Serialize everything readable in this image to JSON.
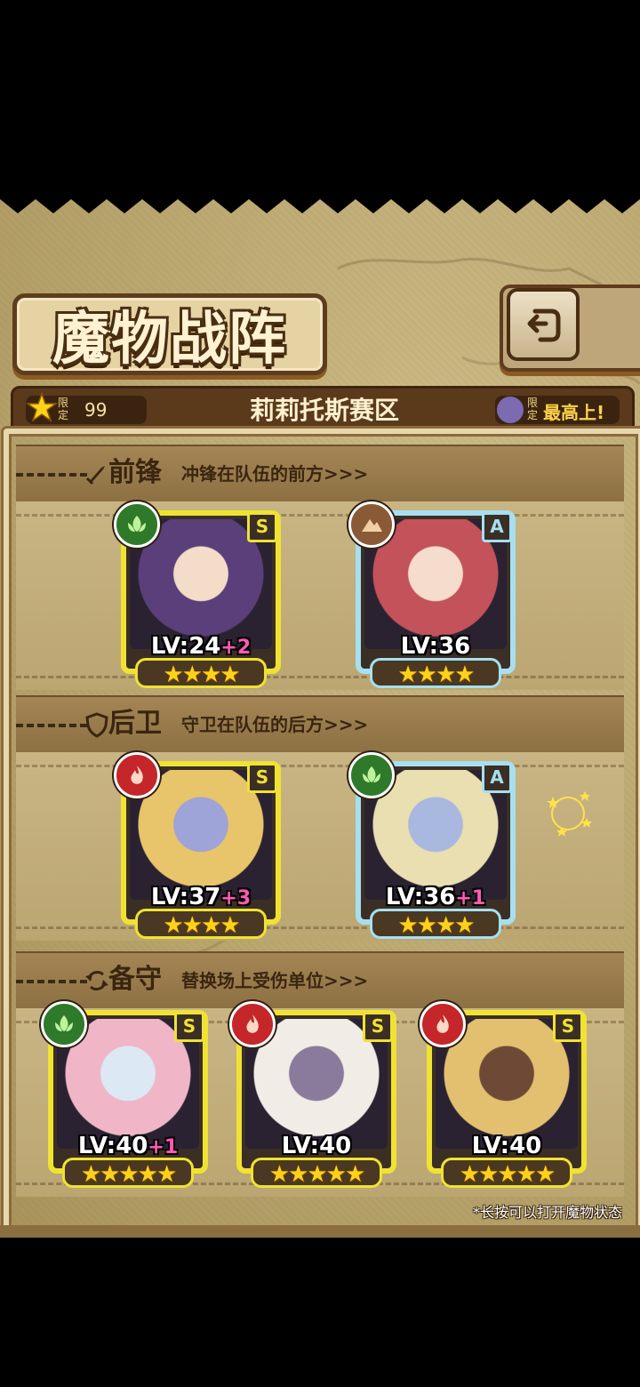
{
  "title": "魔物战阵",
  "header": {
    "limit_tag": "限定",
    "limit_value": "99",
    "region": "莉莉托斯赛区",
    "max_tag": "限定",
    "max_value": "最高上!"
  },
  "sections": [
    {
      "title": "前锋",
      "desc": "冲锋在队伍的前方>>>",
      "icon": "sword-icon"
    },
    {
      "title": "后卫",
      "desc": "守卫在队伍的后方>>>",
      "icon": "shield-icon"
    },
    {
      "title": "备守",
      "desc": "替换场上受伤单位>>>",
      "icon": "swap-icon"
    }
  ],
  "cards": [
    {
      "rank": "S",
      "element": "grass-icon",
      "lv": "LV:24",
      "plus": "+2",
      "stars": 4
    },
    {
      "rank": "A",
      "element": "earth-icon",
      "lv": "LV:36",
      "plus": "",
      "stars": 4
    },
    {
      "rank": "S",
      "element": "fire-icon",
      "lv": "LV:37",
      "plus": "+3",
      "stars": 4
    },
    {
      "rank": "A",
      "element": "grass-icon",
      "lv": "LV:36",
      "plus": "+1",
      "stars": 4
    },
    {
      "rank": "S",
      "element": "grass-icon",
      "lv": "LV:40",
      "plus": "+1",
      "stars": 5
    },
    {
      "rank": "S",
      "element": "fire-icon",
      "lv": "LV:40",
      "plus": "",
      "stars": 5
    },
    {
      "rank": "S",
      "element": "fire-icon",
      "lv": "LV:40",
      "plus": "",
      "stars": 5
    }
  ],
  "hint": "*长按可以打开魔物状态",
  "colors": {
    "rank_s": "#f0e232",
    "rank_a": "#a6dff0",
    "grass": "#2f7a2a",
    "fire": "#c4262a",
    "earth": "#8a5a36"
  }
}
